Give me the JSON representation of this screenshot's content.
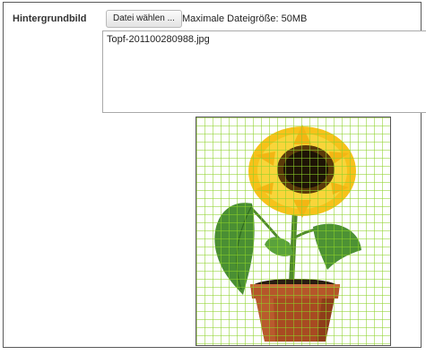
{
  "field": {
    "label": "Hintergrundbild",
    "choose_button_label": "Datei wählen ...",
    "max_size_text": "Maximale Dateigröße: 50MB",
    "selected_file": "Topf-201100280988.jpg"
  },
  "preview": {
    "image_subject": "sunflower-in-pot",
    "grid_color": "#8cd228"
  }
}
